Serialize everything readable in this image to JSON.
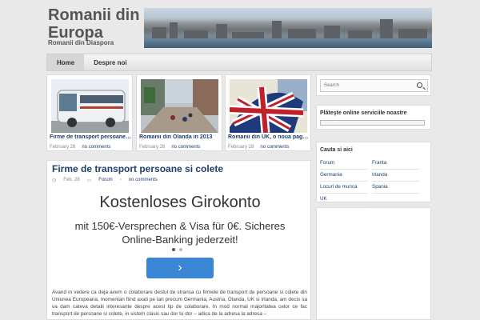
{
  "site": {
    "title": "Romanii din Europa",
    "tagline": "Romanii din Diaspora"
  },
  "nav": {
    "items": [
      {
        "label": "Home"
      },
      {
        "label": "Despre noi"
      }
    ]
  },
  "featured": [
    {
      "title": "Firme de transport persoane si colete",
      "date": "February 28",
      "comments": "no comments"
    },
    {
      "title": "Romanii din Olanda in 2013",
      "date": "February 28",
      "comments": "no comments"
    },
    {
      "title": "Romanii din UK, o noua pagina",
      "date": "February 28",
      "comments": "no comments"
    }
  ],
  "post": {
    "title": "Firme de transport persoane si colete",
    "date": "Feb. 28",
    "category": "Forum",
    "comments": "no comments",
    "ad": {
      "headline": "Kostenloses Girokonto",
      "sub": "mit 150€-Versprechen & Visa für 0€. Sicheres Online-Banking jederzeit!",
      "button": "›"
    },
    "body": "Avand in vedere ca deja avem o colaborare destul de stransa cu firmele de transport de persoane si colete din Uniunea Europeana, momentan fiind axati pe tari precum Germania, Austria, Olanda, UK si Irlanda, am decis sa va dam cateva detalii interesante despre acest tip de colaborare. In mod normal majoritatea celor ce fac transport de persoane si colete, in sistem clasic sau dor to dor – adica de la adresa la adresa –"
  },
  "sidebar": {
    "search_placeholder": "Search",
    "payments_title": "Plăteşte online serviciile noastre",
    "cat_title": "Cauta si aici",
    "cat_left": [
      "Forum",
      "Germania",
      "Locuri de munca",
      "UK"
    ],
    "cat_right": [
      "Franta",
      "Irlanda",
      "Spania"
    ]
  },
  "colors": {
    "link": "#1e3e6e",
    "ad_button": "#3a86d4"
  }
}
